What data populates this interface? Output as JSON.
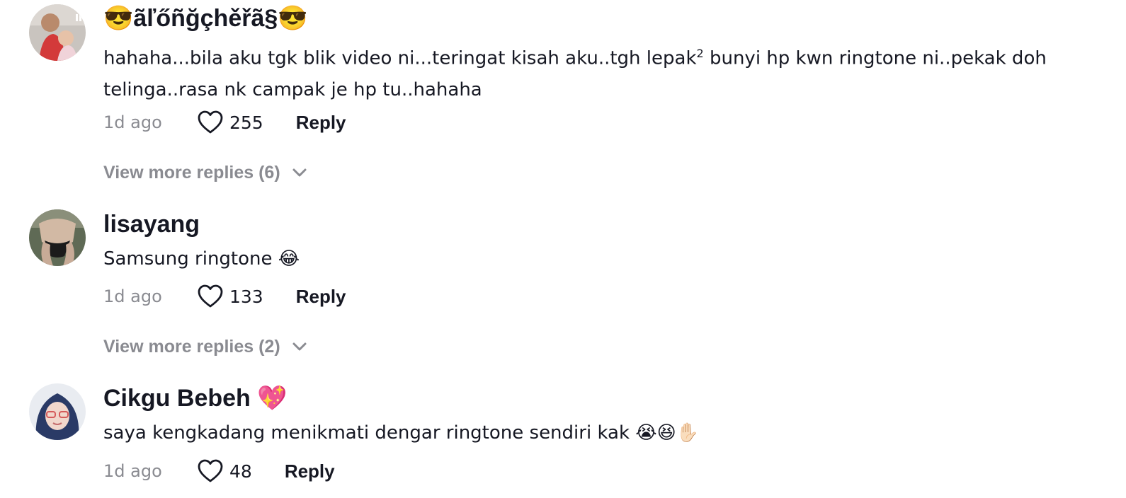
{
  "comments": [
    {
      "username": "😎ãľőñğçhěřã§😎",
      "text_before": "hahaha...bila aku tgk blik video ni...teringat kisah aku..tgh lepak",
      "text_sup": "2",
      "text_after": " bunyi hp kwn ringtone ni..pekak doh telinga..rasa nk campak je hp tu..hahaha",
      "time": "1d ago",
      "likes": "255",
      "reply_label": "Reply",
      "more_replies": "View more replies (6)",
      "avatar_icon": "profile-photo-man-with-baby"
    },
    {
      "username": "lisayang",
      "text": "Samsung ringtone 😂",
      "time": "1d ago",
      "likes": "133",
      "reply_label": "Reply",
      "more_replies": "View more replies (2)",
      "avatar_icon": "profile-photo"
    },
    {
      "username": "Cikgu Bebeh 💖",
      "text": "saya kengkadang menikmati dengar ringtone sendiri kak 😭😆✋🏻",
      "time": "1d ago",
      "likes": "48",
      "reply_label": "Reply",
      "avatar_icon": "profile-photo-woman-hijab"
    }
  ],
  "colors": {
    "primary_text": "#161823",
    "secondary_text": "#8a8b91",
    "background": "#ffffff"
  }
}
